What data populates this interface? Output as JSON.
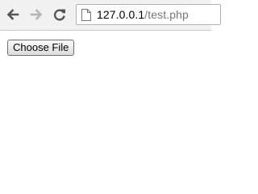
{
  "browser": {
    "url_host": "127.0.0.1",
    "url_path": "/test.php",
    "icons": {
      "back": "back-arrow-icon",
      "forward": "forward-arrow-icon",
      "reload": "reload-icon",
      "page": "page-icon"
    },
    "colors": {
      "toolbar": "#f1f1f1",
      "icon": "#555555",
      "icon_disabled": "#b5b5b5",
      "url_path": "#777777"
    }
  },
  "page": {
    "file_button_label": "Choose File"
  }
}
